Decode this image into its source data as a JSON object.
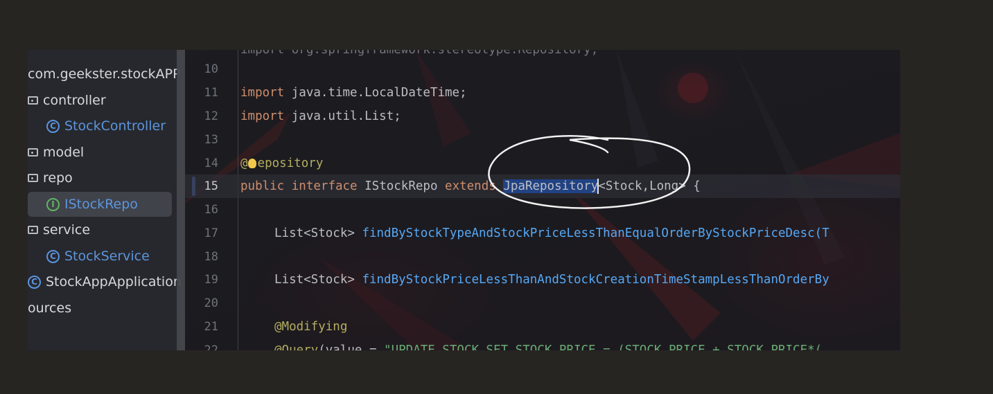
{
  "project_tree": {
    "items": [
      {
        "label": "com.geekster.stockAPP",
        "icon": "none"
      },
      {
        "label": "controller",
        "icon": "folder-icon"
      },
      {
        "label": "StockController",
        "icon": "class-icon"
      },
      {
        "label": "model",
        "icon": "folder-icon"
      },
      {
        "label": "repo",
        "icon": "folder-icon"
      },
      {
        "label": "IStockRepo",
        "icon": "interface-icon",
        "selected": true
      },
      {
        "label": "service",
        "icon": "folder-icon"
      },
      {
        "label": "StockService",
        "icon": "class-icon"
      },
      {
        "label": "StockAppApplication",
        "icon": "class-icon"
      },
      {
        "label": "ources",
        "icon": "none"
      }
    ],
    "class_icon_glyph": "C",
    "interface_icon_glyph": "I"
  },
  "editor": {
    "current_line": "15",
    "lines": [
      {
        "num": "10",
        "text": ""
      },
      {
        "num": "11",
        "kw": "import",
        "rest": " java.time.LocalDateTime;"
      },
      {
        "num": "12",
        "kw": "import",
        "rest": " java.util.List;"
      },
      {
        "num": "13",
        "text": ""
      },
      {
        "num": "14",
        "ann_start": "@",
        "ann_rest": "epository"
      },
      {
        "num": "15",
        "kw1": "public",
        "kw2": "interface",
        "name": " IStockRepo ",
        "kw3": "extends",
        "selected": "JpaRepository",
        "rest": "<Stock,Long> {"
      },
      {
        "num": "16",
        "text": ""
      },
      {
        "num": "17",
        "type": "List<Stock> ",
        "method": "findByStockTypeAndStockPriceLessThanEqualOrderByStockPriceDesc(T"
      },
      {
        "num": "18",
        "text": ""
      },
      {
        "num": "19",
        "type": "List<Stock> ",
        "method": "findByStockPriceLessThanAndStockCreationTimeStampLessThanOrderBy"
      },
      {
        "num": "20",
        "text": ""
      },
      {
        "num": "21",
        "ann": "@Modifying"
      },
      {
        "num": "22",
        "ann": "@Query",
        "rest": "(value = ",
        "str": "\"UPDATE STOCK SET STOCK_PRICE = (STOCK_PRICE + STOCK_PRICE*("
      }
    ],
    "partial_top_line": "import org.springframework.stereotype.Repository;"
  },
  "colors": {
    "keyword": "#cf8e6d",
    "annotation": "#b3ae60",
    "method": "#56a8f5",
    "string": "#6aab73",
    "selection": "#214283",
    "class_icon": "#5b94df",
    "interface_icon": "#5fb563"
  }
}
